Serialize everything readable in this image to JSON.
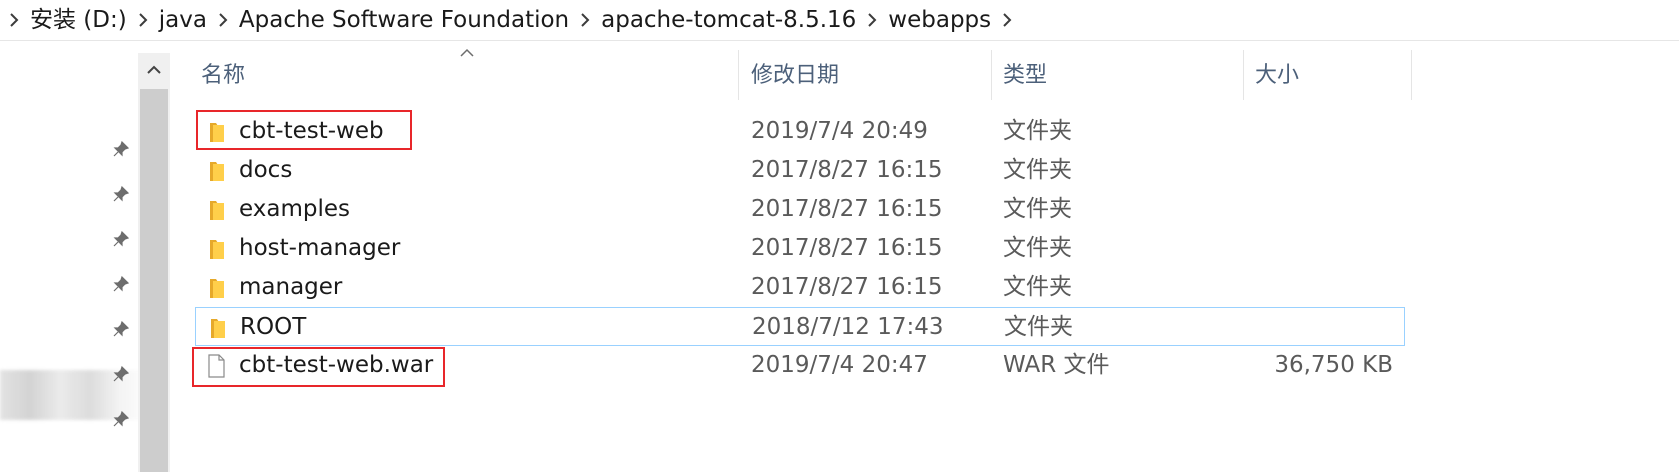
{
  "breadcrumb": {
    "items": [
      "安装 (D:)",
      "java",
      "Apache Software Foundation",
      "apache-tomcat-8.5.16",
      "webapps"
    ]
  },
  "columns": {
    "name": "名称",
    "date": "修改日期",
    "type": "类型",
    "size": "大小"
  },
  "files": [
    {
      "name": "cbt-test-web",
      "date": "2019/7/4 20:49",
      "type": "文件夹",
      "size": "",
      "icon": "folder-icon"
    },
    {
      "name": "docs",
      "date": "2017/8/27 16:15",
      "type": "文件夹",
      "size": "",
      "icon": "folder-icon"
    },
    {
      "name": "examples",
      "date": "2017/8/27 16:15",
      "type": "文件夹",
      "size": "",
      "icon": "folder-icon"
    },
    {
      "name": "host-manager",
      "date": "2017/8/27 16:15",
      "type": "文件夹",
      "size": "",
      "icon": "folder-icon"
    },
    {
      "name": "manager",
      "date": "2017/8/27 16:15",
      "type": "文件夹",
      "size": "",
      "icon": "folder-icon"
    },
    {
      "name": "ROOT",
      "date": "2018/7/12 17:43",
      "type": "文件夹",
      "size": "",
      "icon": "folder-icon"
    },
    {
      "name": "cbt-test-web.war",
      "date": "2019/7/4 20:47",
      "type": "WAR 文件",
      "size": "36,750 KB",
      "icon": "file-icon"
    }
  ],
  "colors": {
    "highlight": "#e8262a",
    "hover_border": "#99d1ff",
    "header_text": "#4c607a",
    "folder": "#ffca3a"
  }
}
